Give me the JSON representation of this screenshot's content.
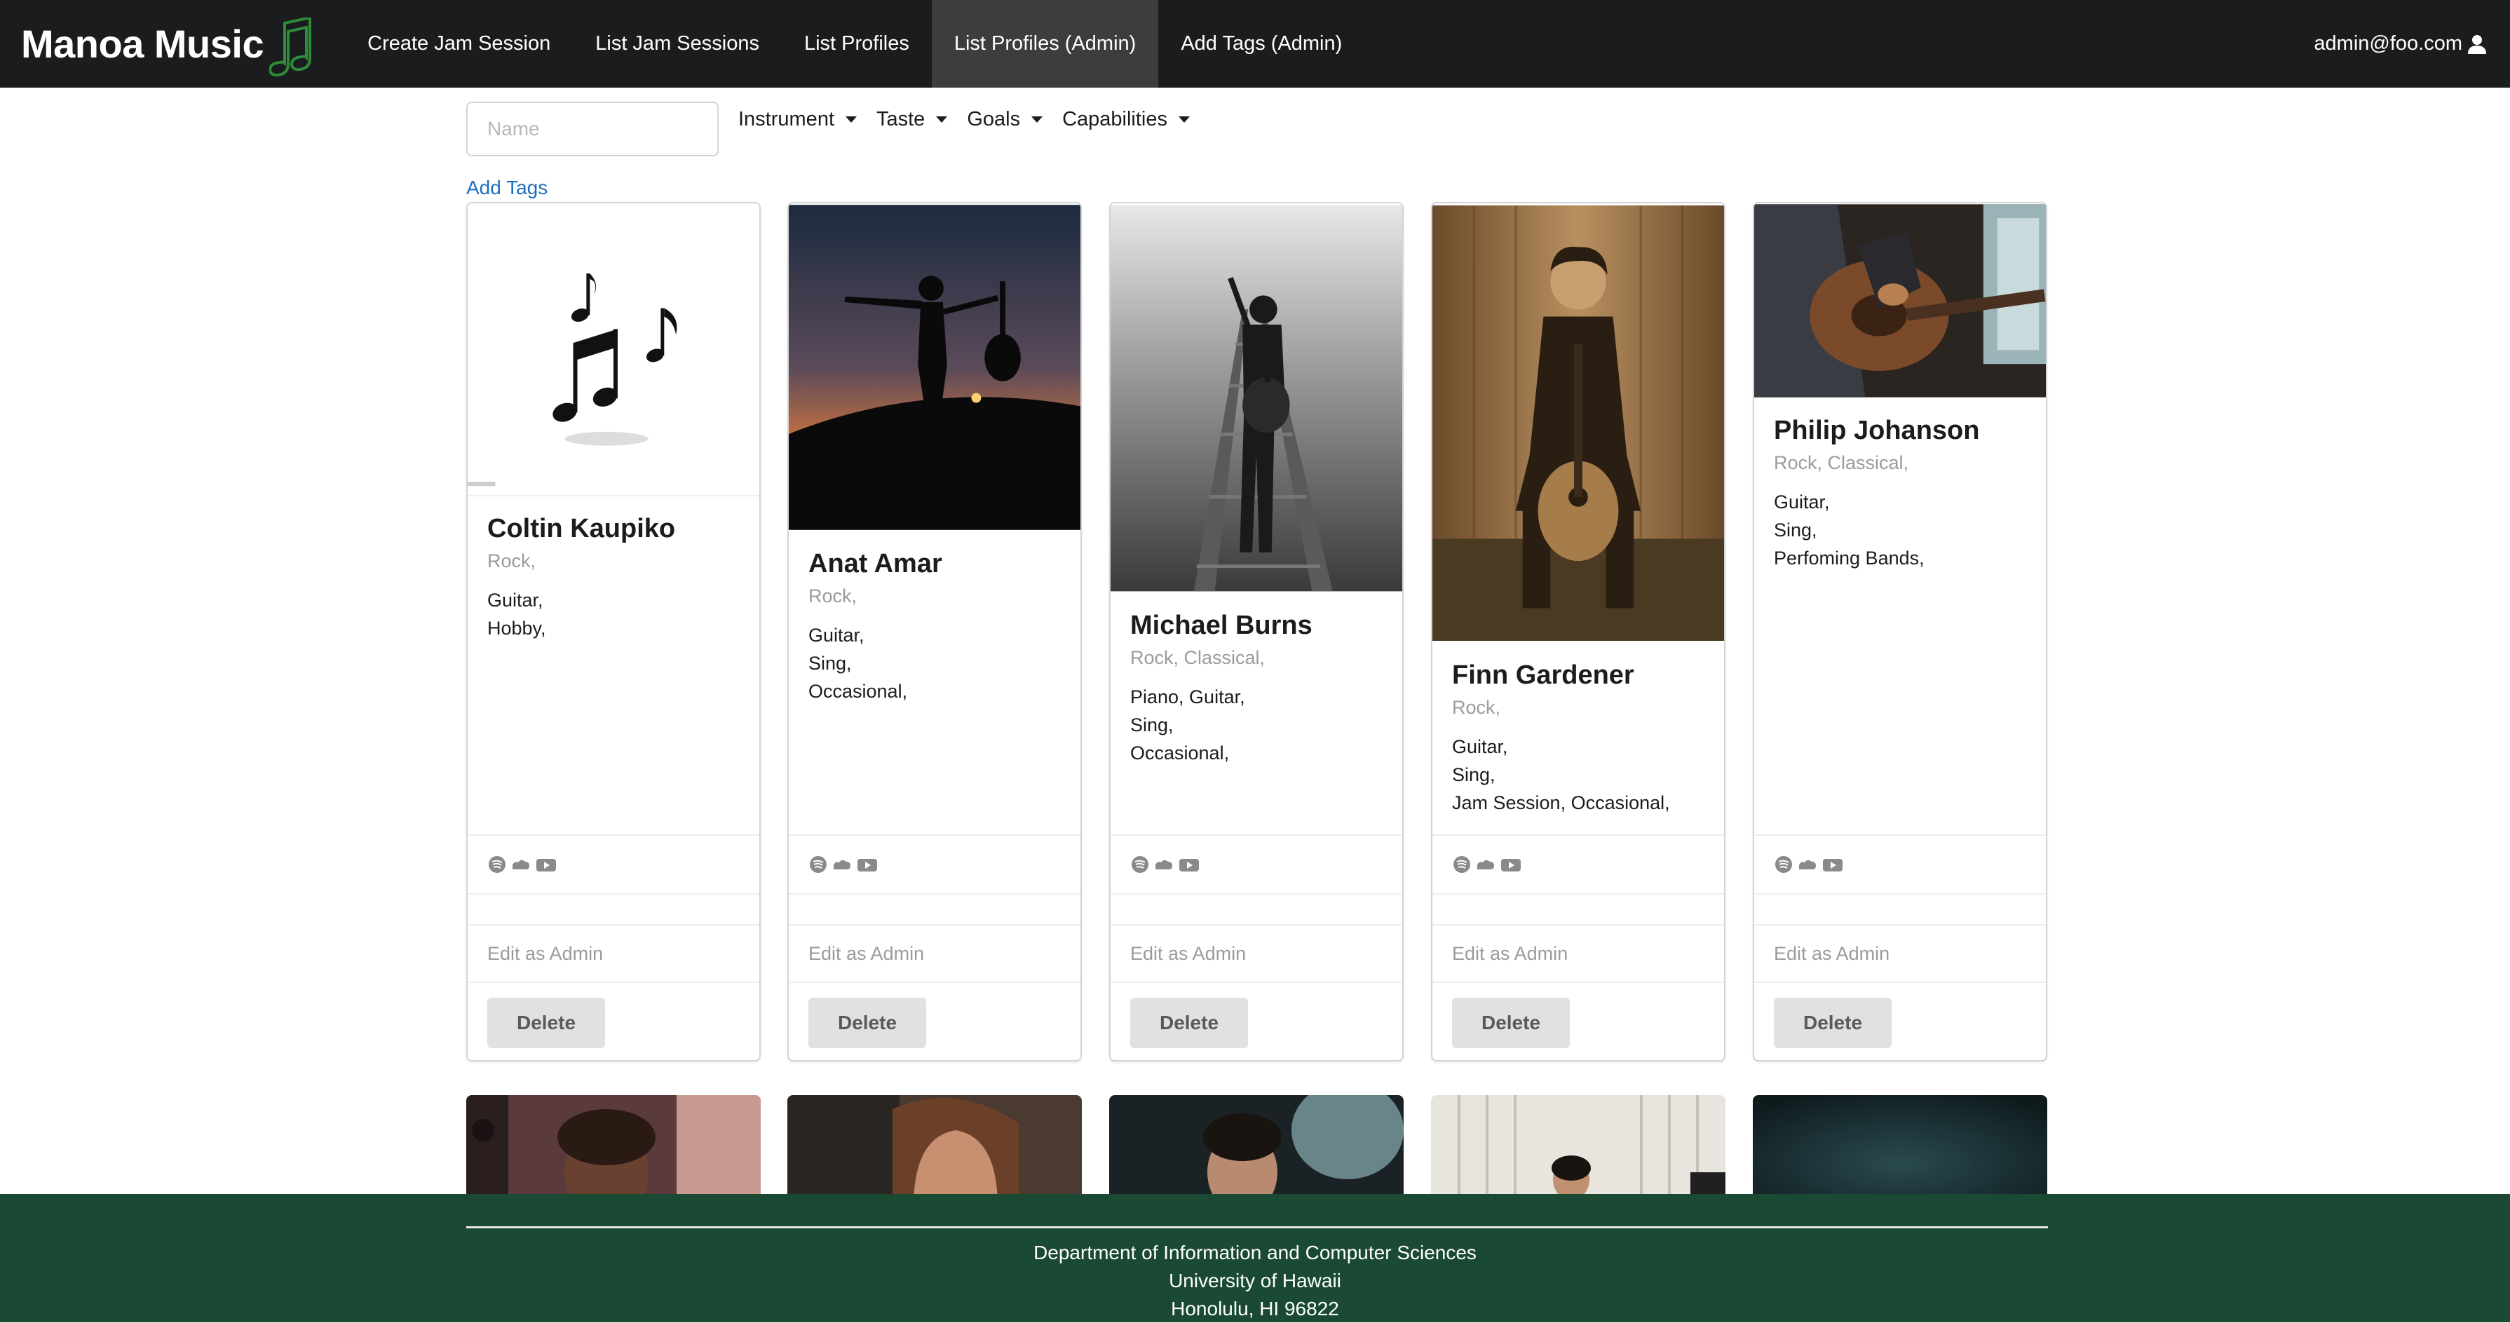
{
  "navbar": {
    "brand": "Manoa Music",
    "items": [
      {
        "label": "Create Jam Session",
        "active": false
      },
      {
        "label": "List Jam Sessions",
        "active": false
      },
      {
        "label": "List Profiles",
        "active": false
      },
      {
        "label": "List Profiles (Admin)",
        "active": true
      },
      {
        "label": "Add Tags (Admin)",
        "active": false
      }
    ],
    "user": "admin@foo.com",
    "icons": {
      "brand": "music-note-icon",
      "user": "user-icon"
    }
  },
  "filters": {
    "name_placeholder": "Name",
    "dropdowns": [
      "Instrument",
      "Taste",
      "Goals",
      "Capabilities"
    ]
  },
  "add_tags_label": "Add Tags",
  "profiles": [
    {
      "name": "Coltin Kaupiko",
      "tastes": "Rock,",
      "desc": [
        "Guitar,",
        "Hobby,"
      ],
      "edit": "Edit as Admin",
      "delete": "Delete"
    },
    {
      "name": "Anat Amar",
      "tastes": "Rock,",
      "desc": [
        "Guitar,",
        "Sing,",
        "Occasional,"
      ],
      "edit": "Edit as Admin",
      "delete": "Delete"
    },
    {
      "name": "Michael Burns",
      "tastes": "Rock, Classical,",
      "desc": [
        "Piano, Guitar,",
        "Sing,",
        "Occasional,"
      ],
      "edit": "Edit as Admin",
      "delete": "Delete"
    },
    {
      "name": "Finn Gardener",
      "tastes": "Rock,",
      "desc": [
        "Guitar,",
        "Sing,",
        "Jam Session, Occasional,"
      ],
      "edit": "Edit as Admin",
      "delete": "Delete"
    },
    {
      "name": "Philip Johanson",
      "tastes": "Rock, Classical,",
      "desc": [
        "Guitar,",
        "Sing,",
        "Perfoming Bands,"
      ],
      "edit": "Edit as Admin",
      "delete": "Delete"
    }
  ],
  "social_icons": [
    "spotify-icon",
    "soundcloud-icon",
    "youtube-icon"
  ],
  "footer": {
    "line1": "Department of Information and Computer Sciences",
    "line2": "University of Hawaii",
    "line3": "Honolulu, HI 96822"
  },
  "colors": {
    "navbar": "#1b1c1d",
    "active_nav": "#3c3d3e",
    "footer": "#1b4a34",
    "link": "#1e70bf",
    "brand_icon": "#2e8b3a"
  }
}
